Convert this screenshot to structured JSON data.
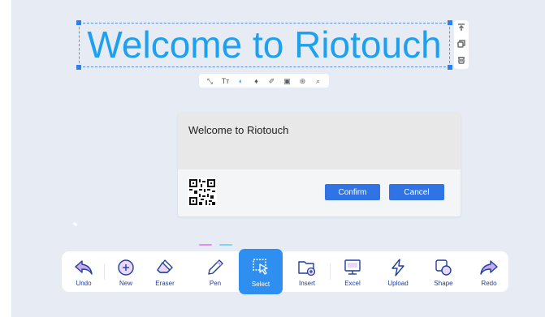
{
  "title": {
    "text": "Welcome to Riotouch"
  },
  "side_tools": [
    "bring-to-top-icon",
    "duplicate-icon",
    "delete-icon"
  ],
  "format_bar": {
    "items": [
      {
        "icon": "text-scale-icon",
        "glyph": "⤡"
      },
      {
        "icon": "text-size-icon",
        "glyph": "Tт"
      },
      {
        "icon": "color-picker-icon",
        "glyph": "◐"
      },
      {
        "icon": "text-style-icon",
        "glyph": "♦"
      },
      {
        "icon": "pen-text-icon",
        "glyph": "✐"
      },
      {
        "icon": "image-text-icon",
        "glyph": "▣"
      },
      {
        "icon": "ocr-icon",
        "glyph": "⊛"
      },
      {
        "icon": "search-icon",
        "glyph": "⌕"
      }
    ]
  },
  "dialog": {
    "message": "Welcome to Riotouch",
    "confirm_label": "Confirm",
    "cancel_label": "Cancel"
  },
  "toolbar": {
    "undo": "Undo",
    "new": "New",
    "eraser": "Eraser",
    "pen": "Pen",
    "select": "Select",
    "insert": "Insert",
    "excel": "Excel",
    "upload": "Upload",
    "shape": "Shape",
    "redo": "Redo"
  },
  "colors": {
    "title": "#1ea0f0",
    "accent": "#2f73e5",
    "active_tool": "#2e8ff0",
    "tool_label": "#1f3f9a",
    "tool_icon_outline": "#1f3f9a",
    "tool_icon_fill": "#c9a8f2",
    "canvas_background": "#e7ecf4"
  }
}
